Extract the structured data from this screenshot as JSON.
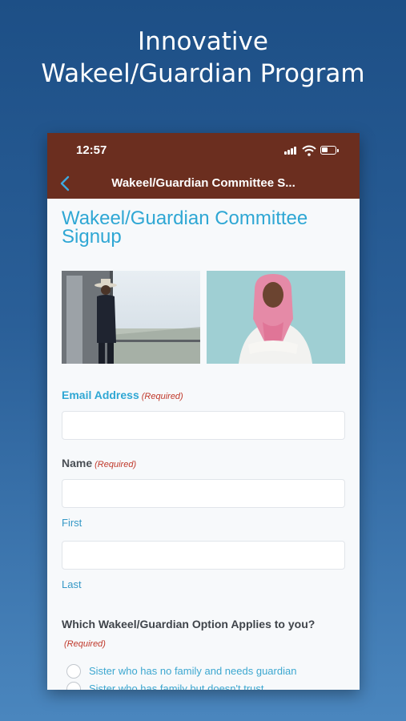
{
  "promo": {
    "line1": "Innovative",
    "line2": "Wakeel/Guardian Program"
  },
  "status_bar": {
    "time": "12:57",
    "icons": [
      "signal-icon",
      "wifi-icon",
      "battery-icon"
    ]
  },
  "nav": {
    "back_icon": "chevron-left-icon",
    "title": "Wakeel/Guardian Committee S..."
  },
  "form": {
    "title_line1": "Wakeel/Guardian Committee",
    "title_line2": "Signup",
    "email": {
      "label": "Email Address",
      "required": "(Required)",
      "value": ""
    },
    "name": {
      "label": "Name",
      "required": "(Required)",
      "first": {
        "value": "",
        "sublabel": "First"
      },
      "last": {
        "value": "",
        "sublabel": "Last"
      }
    },
    "option_question": {
      "label": "Which Wakeel/Guardian Option Applies to you?",
      "required": "(Required)",
      "options": [
        "Sister who has no family and needs guardian",
        "Sister who has family but doesn't trust"
      ]
    }
  },
  "colors": {
    "background_top": "#1d4f86",
    "header_brown": "#6b2e1f",
    "accent_blue": "#2fa7d4",
    "required_red": "#c0392b"
  }
}
